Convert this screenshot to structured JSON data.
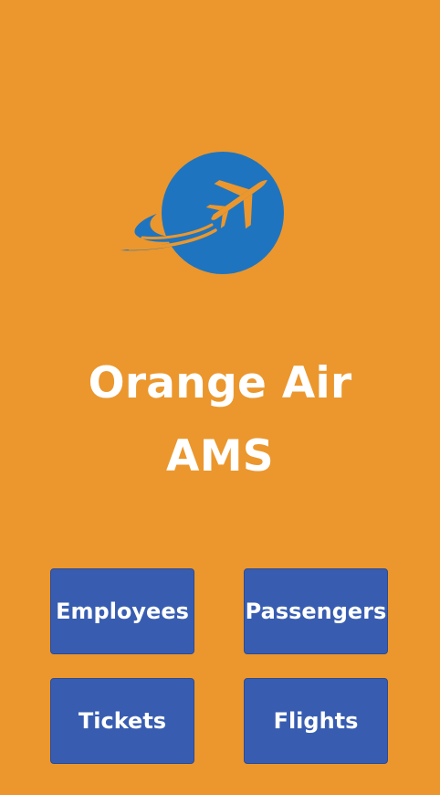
{
  "app": {
    "title_line1": "Orange Air",
    "title_line2": "AMS"
  },
  "logo": {
    "icon": "airplane-globe-icon",
    "circle_color": "#1F74BF",
    "plane_color": "#EB972D"
  },
  "colors": {
    "background": "#EB972D",
    "button": "#385DB0",
    "text": "#FFFFFF"
  },
  "menu": {
    "employees_label": "Employees",
    "passengers_label": "Passengers",
    "tickets_label": "Tickets",
    "flights_label": "Flights"
  }
}
